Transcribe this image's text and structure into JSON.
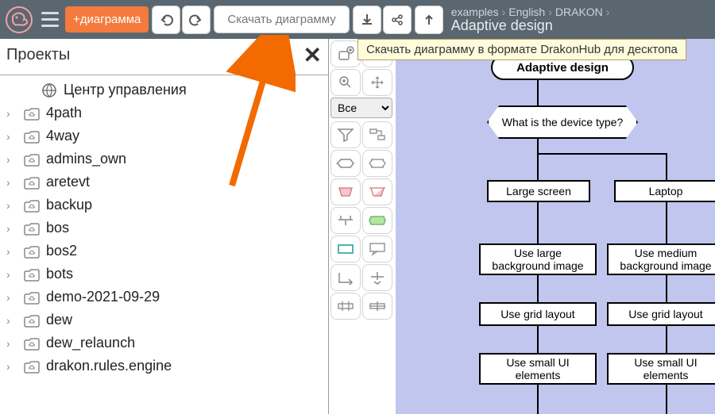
{
  "topbar": {
    "add_diagram": "+диаграмма",
    "download_label": "Скачать диаграмму"
  },
  "breadcrumb": {
    "parts": [
      "examples",
      "English",
      "DRAKON"
    ],
    "title": "Adaptive design"
  },
  "tooltip": "Скачать диаграмму в формате DrakonHub для десктопа",
  "sidebar": {
    "title": "Проекты",
    "items": [
      {
        "label": "Центр управления",
        "type": "control"
      },
      {
        "label": "4path",
        "type": "cloud"
      },
      {
        "label": "4way",
        "type": "cloud"
      },
      {
        "label": "admins_own",
        "type": "cloud"
      },
      {
        "label": "aretevt",
        "type": "cloud"
      },
      {
        "label": "backup",
        "type": "cloud"
      },
      {
        "label": "bos",
        "type": "cloud"
      },
      {
        "label": "bos2",
        "type": "cloud"
      },
      {
        "label": "bots",
        "type": "cloud"
      },
      {
        "label": "demo-2021-09-29",
        "type": "cloud"
      },
      {
        "label": "dew",
        "type": "cloud"
      },
      {
        "label": "dew_relaunch",
        "type": "cloud"
      },
      {
        "label": "drakon.rules.engine",
        "type": "cloud"
      }
    ]
  },
  "palette": {
    "filter": "Все"
  },
  "flowchart": {
    "title": "Adaptive design",
    "question": "What is the device type?",
    "branches": [
      {
        "header": "Large screen",
        "steps": [
          "Use large background image",
          "Use grid layout",
          "Use small UI elements"
        ]
      },
      {
        "header": "Laptop",
        "steps": [
          "Use medium background image",
          "Use grid layout",
          "Use small UI elements"
        ]
      }
    ]
  }
}
